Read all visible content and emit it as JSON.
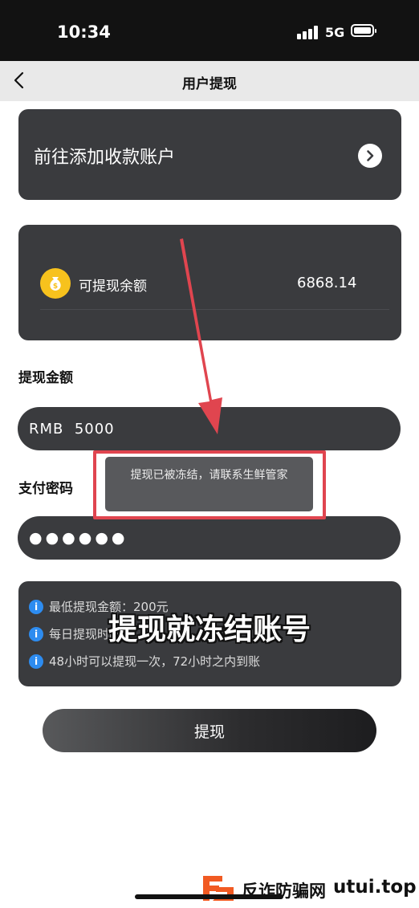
{
  "status_bar": {
    "time": "10:34",
    "network": "5G"
  },
  "header": {
    "title": "用户提现"
  },
  "add_account": {
    "label": "前往添加收款账户"
  },
  "balance": {
    "label": "可提现余额",
    "value": "6868.14"
  },
  "amount": {
    "label": "提现金额",
    "value": "RMB  5000"
  },
  "password": {
    "label": "支付密码",
    "value": "●●●●●●"
  },
  "toast": {
    "message": "提现已被冻结，请联系生鲜管家"
  },
  "info": {
    "items": [
      {
        "text": "最低提现金额：200元"
      },
      {
        "text": "每日提现时间"
      },
      {
        "text": "48小时可以提现一次，72小时之内到账"
      }
    ]
  },
  "overlay": {
    "caption": "提现就冻结账号"
  },
  "submit": {
    "label": "提现"
  },
  "watermark": {
    "text": "反诈防骗网",
    "site": "utui.top"
  },
  "colors": {
    "card_bg": "#3a3b3e",
    "accent_red": "#e0454f",
    "info_blue": "#2d8cf0",
    "coin_yellow": "#f7c21d",
    "brand_orange": "#f15a22"
  },
  "icons": [
    "back-icon",
    "chevron-right-icon",
    "moneybag-icon",
    "info-icon",
    "brand-logo"
  ]
}
